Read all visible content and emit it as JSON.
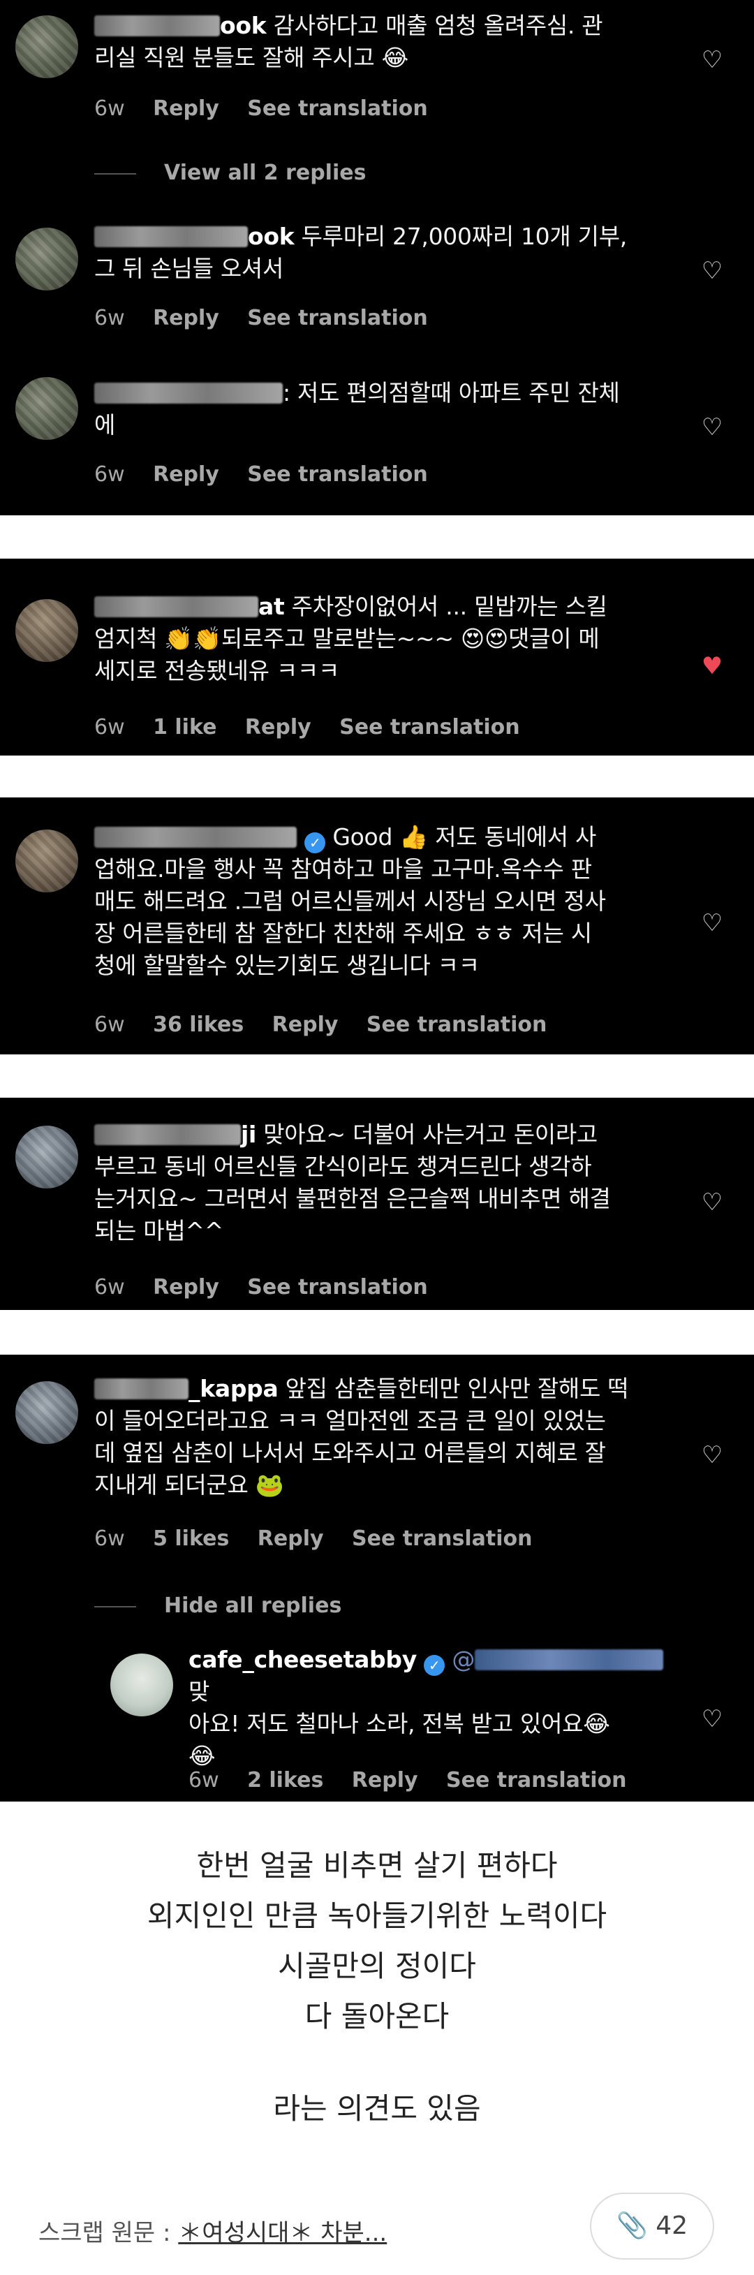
{
  "comments": [
    {
      "username_suffix": "ook",
      "text": " 감사하다고 매출 엄청 올려주심. 관\n리실 직원 분들도 잘해 주시고 😂",
      "age": "6w",
      "likes": "",
      "reply_label": "Reply",
      "translate_label": "See translation"
    },
    {
      "username_suffix": "ook",
      "text": " 두루마리 27,000짜리 10개 기부,\n그 뒤 손님들 오셔서",
      "age": "6w",
      "likes": "",
      "reply_label": "Reply",
      "translate_label": "See translation"
    },
    {
      "username_suffix": "",
      "text": ": 저도 편의점할때 아파트 주민 잔체\n에",
      "age": "6w",
      "likes": "",
      "reply_label": "Reply",
      "translate_label": "See translation"
    },
    {
      "username_suffix": "at",
      "text": " 주차장이없어서 ... 밑밥까는 스킬\n엄지척 👏👏되로주고 말로받는~~~ 😍😍댓글이 메\n세지로 전송됐네유 ㅋㅋㅋ",
      "age": "6w",
      "likes": "1 like",
      "reply_label": "Reply",
      "translate_label": "See translation"
    },
    {
      "username_suffix": "",
      "text": " Good 👍 저도 동네에서 사\n업해요.마을 행사 꼭 참여하고 마을 고구마.옥수수 판\n매도 해드려요 .그럼 어르신들께서 시장님 오시면 정사\n장 어른들한테 참 잘한다 친찬해 주세요 ㅎㅎ 저는 시\n청에 할말할수 있는기회도 생깁니다 ㅋㅋ",
      "age": "6w",
      "likes": "36 likes",
      "reply_label": "Reply",
      "translate_label": "See translation"
    },
    {
      "username_suffix": "ji",
      "text": " 맞아요~ 더불어 사는거고 돈이라고\n부르고 동네 어르신들 간식이라도 챙겨드린다 생각하\n는거지요~ 그러면서 불편한점 은근슬쩍 내비추면 해결\n되는 마법^^",
      "age": "6w",
      "likes": "",
      "reply_label": "Reply",
      "translate_label": "See translation"
    },
    {
      "username_suffix": "_kappa",
      "text": " 앞집 삼춘들한테만 인사만 잘해도 떡\n이 들어오더라고요 ㅋㅋ 얼마전엔 조금 큰 일이 있었는\n데 옆집 삼춘이 나서서 도와주시고 어른들의 지혜로 잘\n지내게 되더군요 🐸",
      "age": "6w",
      "likes": "5 likes",
      "reply_label": "Reply",
      "translate_label": "See translation"
    }
  ],
  "view_replies_label": "View all 2 replies",
  "hide_replies_label": "Hide all replies",
  "reply": {
    "username": "cafe_cheesetabby",
    "mention": "@",
    "text": " 맞\n아요! 저도 철마나 소라, 전복 받고 있어요😂\n😂",
    "age": "6w",
    "likes": "2 likes",
    "reply_label": "Reply",
    "translate_label": "See translation"
  },
  "article": {
    "lines": [
      "한번 얼굴 비추면 살기 편하다",
      "외지인인 만큼 녹아들기위한 노력이다",
      "시골만의 정이다",
      "다 돌아온다"
    ],
    "closing": "라는 의견도 있음"
  },
  "footer": {
    "scrap_label": "스크랩 원문 :",
    "scrap_link": "＊여성시대＊ 차분...",
    "clip_count": "42"
  },
  "colors": {
    "background_dark": "#000000",
    "meta_gray": "#a8a8a8",
    "like_red": "#ed4956",
    "verified_blue": "#3797f0"
  },
  "icons": [
    "heart-icon",
    "heart-filled-icon",
    "verified-badge-icon",
    "paperclip-icon"
  ]
}
